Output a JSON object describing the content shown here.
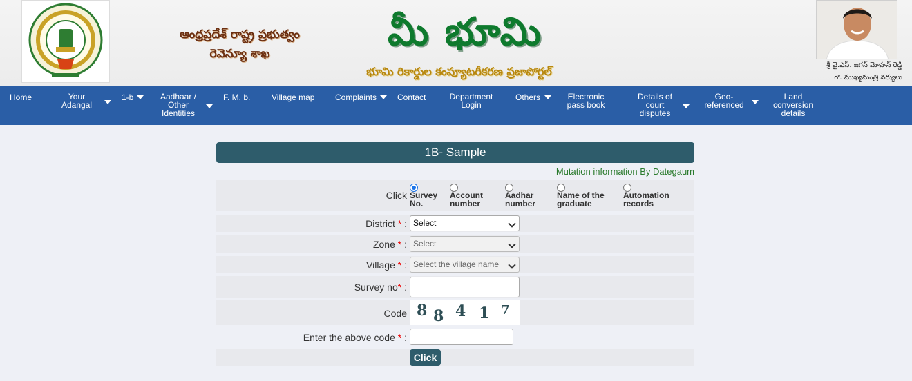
{
  "header": {
    "state_line1": "ఆంధ్రప్రదేశ్ రాష్ట్ర ప్రభుత్వం",
    "state_line2": "రెవెన్యూ శాఖ",
    "brand": "మీ భూమి",
    "brand_sub": "భూమి రికార్డుల కంప్యూటరీకరణ ప్రజాపోర్టల్",
    "cm_name": "శ్రీ వై.ఎస్. జగన్ మోహన్ రెడ్డి",
    "cm_title": "గౌ. ముఖ్యమంత్రి వర్యులు"
  },
  "nav": {
    "items": [
      {
        "label": "Home"
      },
      {
        "label": "Your Adangal"
      },
      {
        "label": "1-b"
      },
      {
        "label": "Aadhaar / Other Identities"
      },
      {
        "label": "F. M. b."
      },
      {
        "label": "Village map"
      },
      {
        "label": "Complaints"
      },
      {
        "label": "Contact"
      },
      {
        "label": "Department Login"
      },
      {
        "label": "Others"
      },
      {
        "label": "Electronic pass book"
      },
      {
        "label": "Details of court disputes"
      },
      {
        "label": "Geo-referenced"
      },
      {
        "label": "Land conversion details"
      }
    ]
  },
  "form": {
    "title": "1B- Sample",
    "subnote": "Mutation information By Dategaum",
    "click_label": "Click",
    "search_options": [
      {
        "label": "Survey No.",
        "selected": true
      },
      {
        "label": "Account number",
        "selected": false
      },
      {
        "label": "Aadhar number",
        "selected": false
      },
      {
        "label": "Name of the graduate",
        "selected": false
      },
      {
        "label": "Automation records",
        "selected": false
      }
    ],
    "district_label": "District",
    "district_value": "Select",
    "zone_label": "Zone",
    "zone_value": "Select",
    "village_label": "Village",
    "village_value": "Select the village name",
    "survey_label": "Survey no",
    "survey_value": "",
    "code_label": "Code",
    "captcha": [
      "8",
      "8",
      "4",
      "1",
      "7"
    ],
    "enter_code_label": "Enter the above code",
    "enter_code_value": "",
    "submit_label": "Click",
    "required_mark": "*",
    "colon": ":"
  }
}
